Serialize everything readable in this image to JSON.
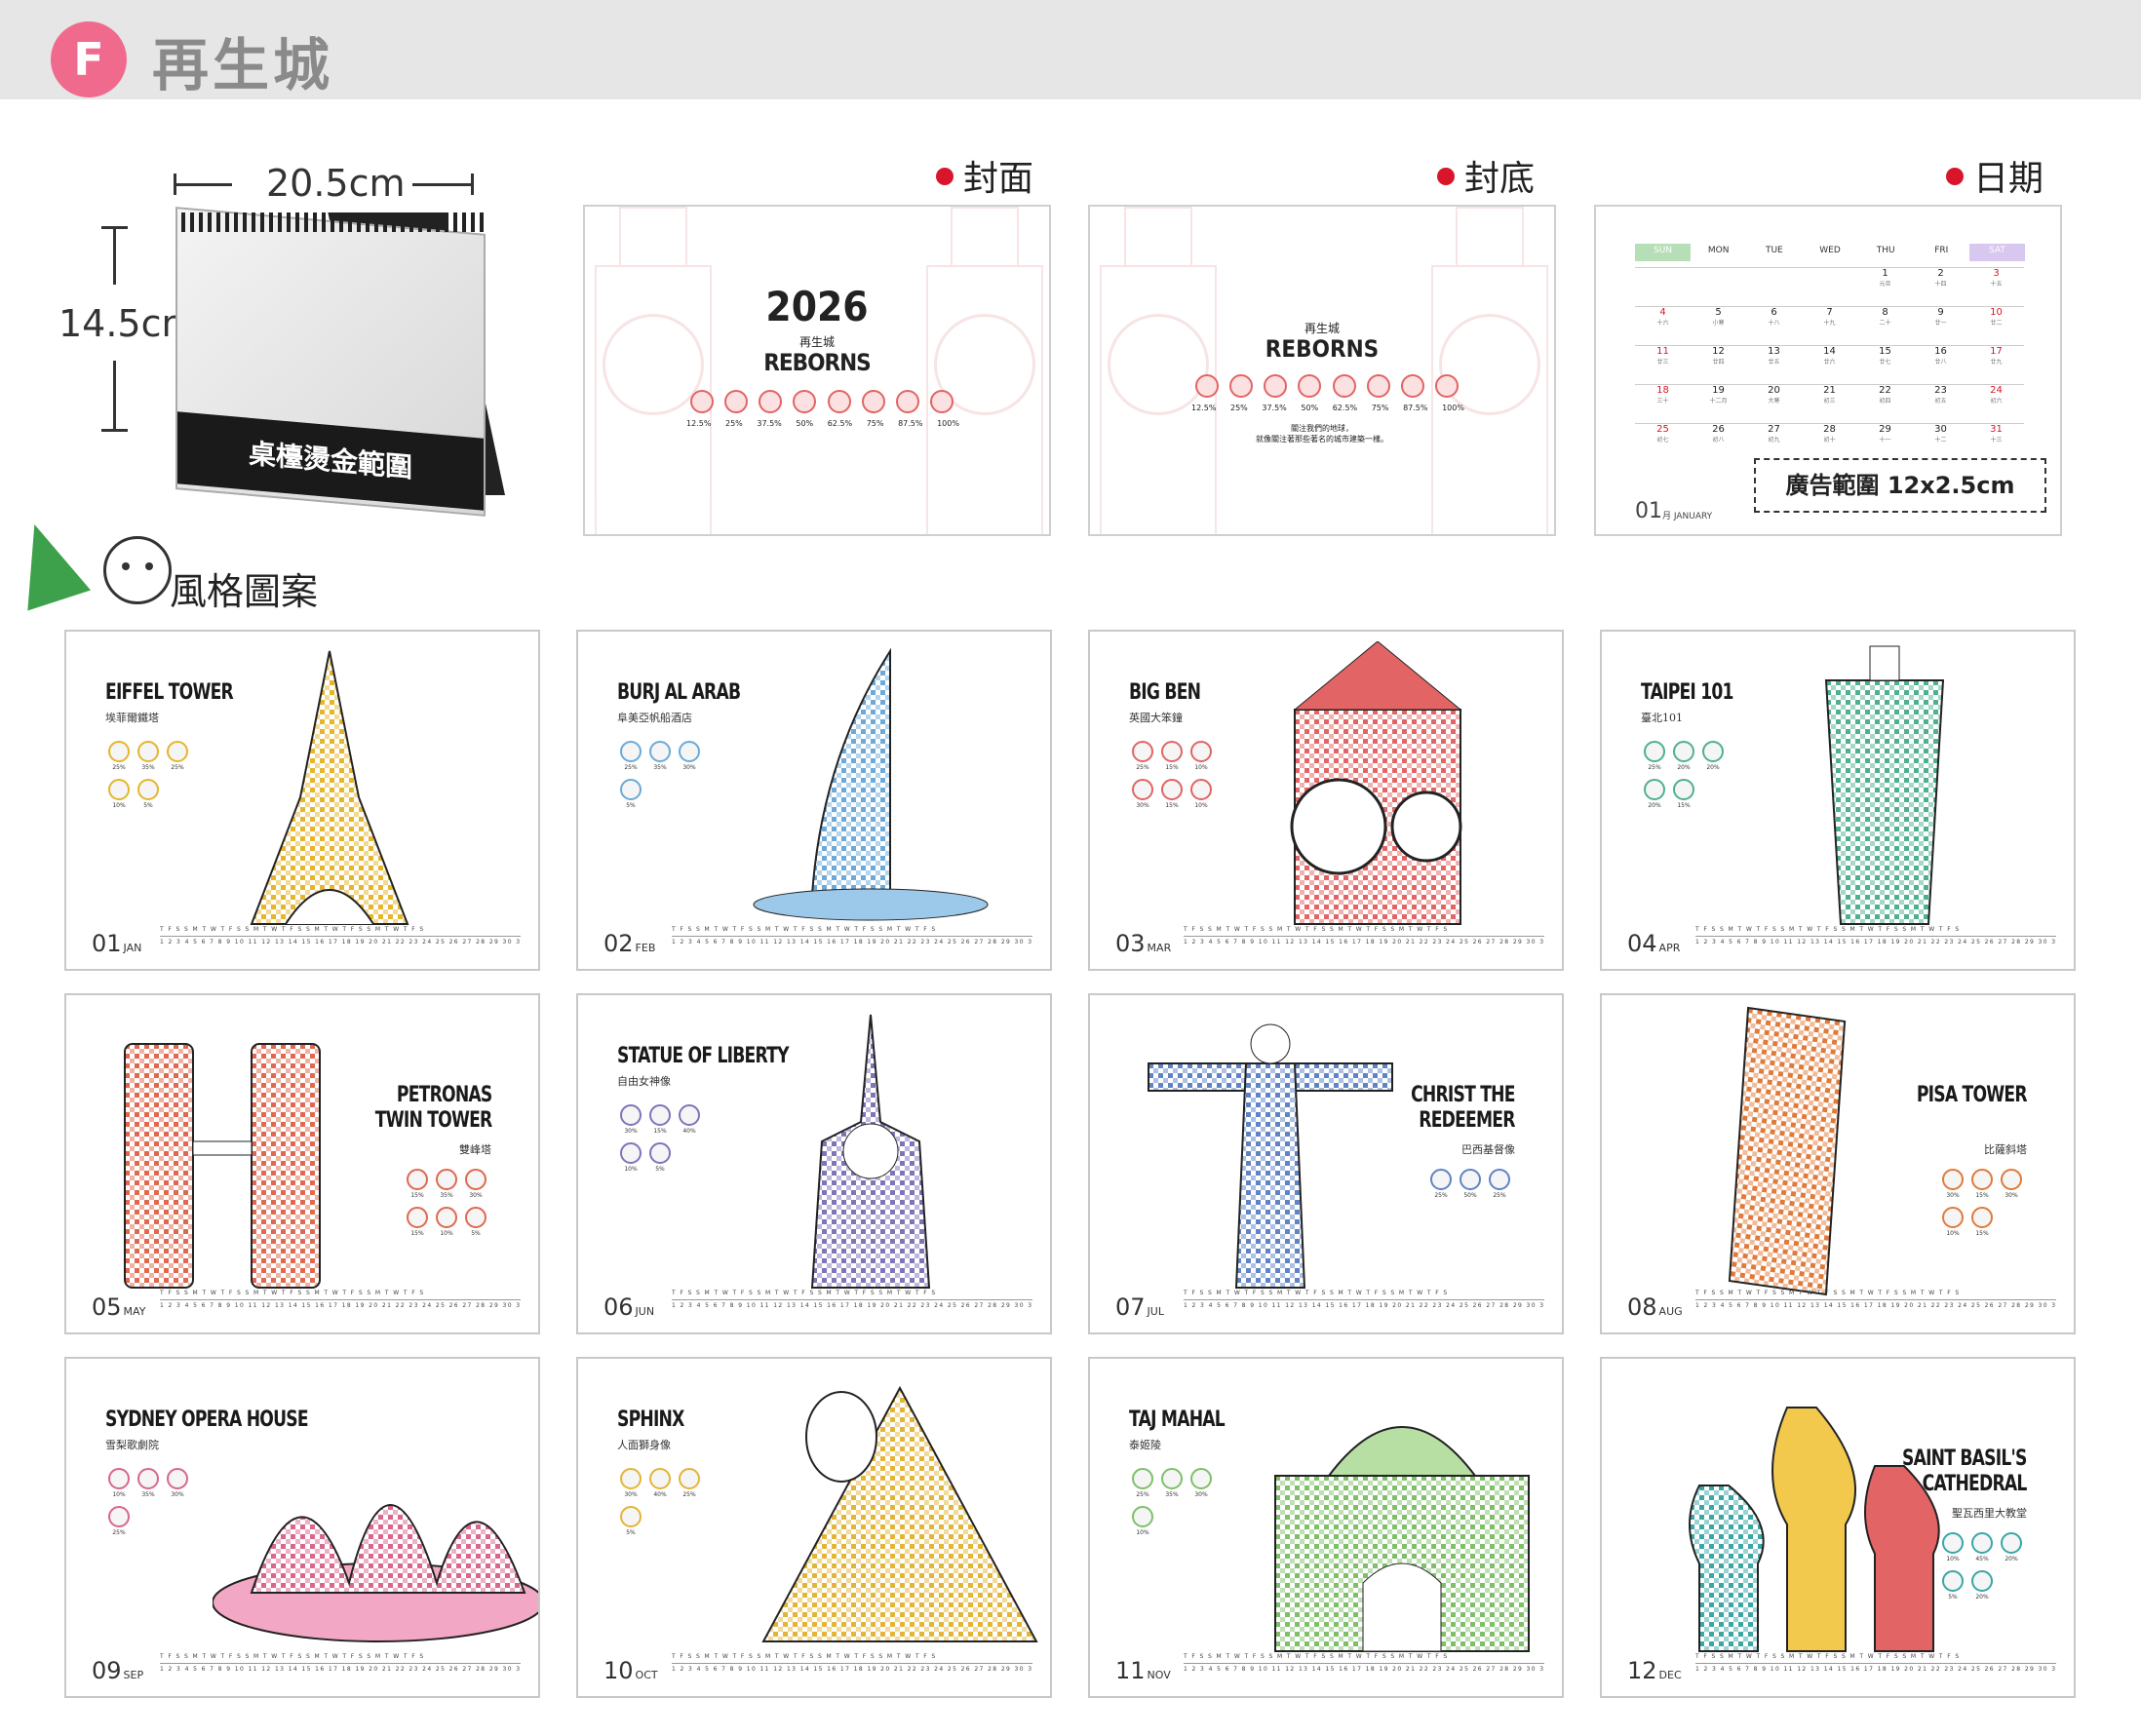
{
  "header": {
    "badge": "F",
    "title": "再生城"
  },
  "spec": {
    "width_label": "20.5cm",
    "height_label": "14.5cm",
    "banner_text": "桌檯燙金範圍"
  },
  "variants": [
    {
      "label": "封面"
    },
    {
      "label": "封底"
    },
    {
      "label": "日期"
    }
  ],
  "cover": {
    "year": "2026",
    "zh_title": "再生城",
    "en_title": "REBORNS",
    "percents": [
      "12.5%",
      "25%",
      "37.5%",
      "50%",
      "62.5%",
      "75%",
      "87.5%",
      "100%"
    ]
  },
  "back": {
    "zh_title": "再生城",
    "en_title": "REBORNS",
    "percents": [
      "12.5%",
      "25%",
      "37.5%",
      "50%",
      "62.5%",
      "75%",
      "87.5%",
      "100%"
    ],
    "text_line1": "關注我們的地球，",
    "text_line2": "就像關注著那些著名的城市建築一樣。"
  },
  "date_layout": {
    "weekdays": [
      "SUN",
      "MON",
      "TUE",
      "WED",
      "THU",
      "FRI",
      "SAT"
    ],
    "days": [
      [
        "",
        "",
        "",
        "",
        "1",
        "2",
        "3"
      ],
      [
        "4",
        "5",
        "6",
        "7",
        "8",
        "9",
        "10"
      ],
      [
        "11",
        "12",
        "13",
        "14",
        "15",
        "16",
        "17"
      ],
      [
        "18",
        "19",
        "20",
        "21",
        "22",
        "23",
        "24"
      ],
      [
        "25",
        "26",
        "27",
        "28",
        "29",
        "30",
        "31"
      ]
    ],
    "lunar": [
      [
        "",
        "",
        "",
        "",
        "元旦",
        "十四",
        "十五"
      ],
      [
        "十六",
        "小寒",
        "十八",
        "十九",
        "二十",
        "廿一",
        "廿二"
      ],
      [
        "廿三",
        "廿四",
        "廿五",
        "廿六",
        "廿七",
        "廿八",
        "廿九"
      ],
      [
        "三十",
        "十二月",
        "大寒",
        "初三",
        "初四",
        "初五",
        "初六"
      ],
      [
        "初七",
        "初八",
        "初九",
        "初十",
        "十一",
        "十二",
        "十三"
      ]
    ],
    "month_num": "01",
    "month_name": "月 JANUARY",
    "ad_text": "廣告範圍 12x2.5cm"
  },
  "style_heading": "風格圖案",
  "months": [
    {
      "num": "01",
      "abbr": "JAN",
      "name": "EIFFEL TOWER",
      "zh": "埃菲爾鐵塔",
      "stats": [
        "25%",
        "35%",
        "25%",
        "10%",
        "5%"
      ],
      "accent": "#e5b52a"
    },
    {
      "num": "02",
      "abbr": "FEB",
      "name": "BURJ AL ARAB",
      "zh": "阜美亞帆船酒店",
      "stats": [
        "25%",
        "35%",
        "30%",
        "5%"
      ],
      "accent": "#6aa9d9"
    },
    {
      "num": "03",
      "abbr": "MAR",
      "name": "BIG BEN",
      "zh": "英國大笨鐘",
      "stats": [
        "25%",
        "15%",
        "10%",
        "30%",
        "15%",
        "10%"
      ],
      "accent": "#e26464"
    },
    {
      "num": "04",
      "abbr": "APR",
      "name": "TAIPEI 101",
      "zh": "臺北101",
      "stats": [
        "25%",
        "20%",
        "20%",
        "20%",
        "15%"
      ],
      "accent": "#4fb08f"
    },
    {
      "num": "05",
      "abbr": "MAY",
      "name": "PETRONAS\nTWIN TOWER",
      "zh": "雙峰塔",
      "stats": [
        "15%",
        "35%",
        "30%",
        "15%",
        "10%",
        "5%"
      ],
      "accent": "#e0684e"
    },
    {
      "num": "06",
      "abbr": "JUN",
      "name": "STATUE OF LIBERTY",
      "zh": "自由女神像",
      "stats": [
        "30%",
        "15%",
        "40%",
        "10%",
        "5%"
      ],
      "accent": "#7e74b8"
    },
    {
      "num": "07",
      "abbr": "JUL",
      "name": "CHRIST THE\nREDEEMER",
      "zh": "巴西基督像",
      "stats": [
        "25%",
        "50%",
        "25%"
      ],
      "accent": "#5f84c6"
    },
    {
      "num": "08",
      "abbr": "AUG",
      "name": "PISA TOWER",
      "zh": "比薩斜塔",
      "stats": [
        "30%",
        "15%",
        "30%",
        "10%",
        "15%"
      ],
      "accent": "#e07a3a"
    },
    {
      "num": "09",
      "abbr": "SEP",
      "name": "SYDNEY OPERA HOUSE",
      "zh": "雪梨歌劇院",
      "stats": [
        "10%",
        "35%",
        "30%",
        "25%"
      ],
      "accent": "#d9668e"
    },
    {
      "num": "10",
      "abbr": "OCT",
      "name": "SPHINX",
      "zh": "人面獅身像",
      "stats": [
        "30%",
        "40%",
        "25%",
        "5%"
      ],
      "accent": "#e3b536"
    },
    {
      "num": "11",
      "abbr": "NOV",
      "name": "TAJ MAHAL",
      "zh": "泰姬陵",
      "stats": [
        "25%",
        "35%",
        "30%",
        "10%"
      ],
      "accent": "#7fbf6a"
    },
    {
      "num": "12",
      "abbr": "DEC",
      "name": "SAINT BASIL'S\nCATHEDRAL",
      "zh": "聖瓦西里大教堂",
      "stats": [
        "10%",
        "45%",
        "20%",
        "5%",
        "20%"
      ],
      "accent": "#3aa6a6"
    }
  ],
  "day_strip": {
    "letters": "T F S S M T W T F S S M T W T F S S M T W T F S S M T W T F S",
    "nums": "1 2 3 4 5 6 7 8 9 10 11 12 13 14 15 16 17 18 19 20 21 22 23 24 25 26 27 28 29 30 31"
  }
}
